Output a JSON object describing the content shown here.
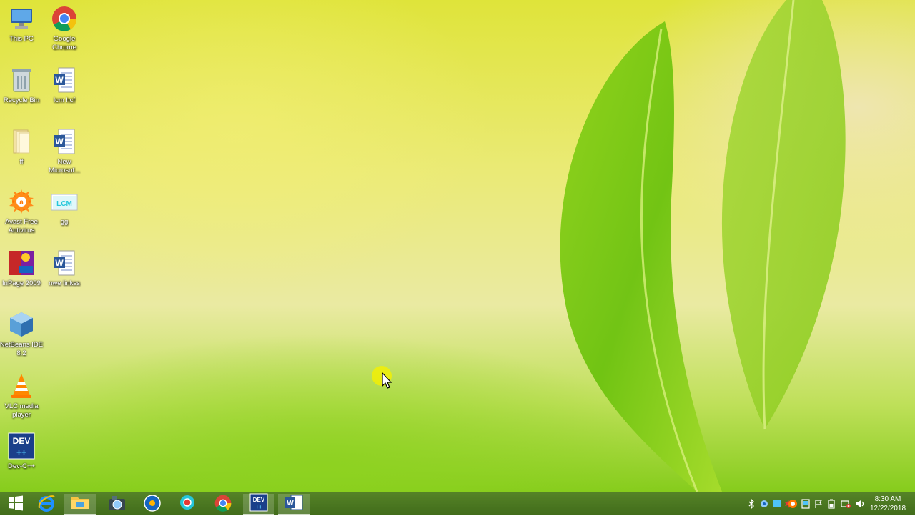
{
  "desktop": {
    "icons": [
      {
        "label": "This PC"
      },
      {
        "label": "Google Chrome"
      },
      {
        "label": "Recycle Bin"
      },
      {
        "label": "lcm hcf"
      },
      {
        "label": "ff"
      },
      {
        "label": "New Microsof..."
      },
      {
        "label": "Avast Free Antivirus"
      },
      {
        "label": "gg"
      },
      {
        "label": "InPage 2009"
      },
      {
        "label": "nwe linkss"
      },
      {
        "label": "NetBeans IDE 8.2"
      },
      {
        "label": "VLC media player"
      },
      {
        "label": "Dev-C++"
      }
    ]
  },
  "taskbar": {
    "buttons": [
      {
        "icon": "windows-start-icon"
      },
      {
        "icon": "internet-explorer-icon"
      },
      {
        "icon": "file-explorer-icon"
      },
      {
        "icon": "camera-app-icon"
      },
      {
        "icon": "media-player-icon"
      },
      {
        "icon": "recorder-app-icon"
      },
      {
        "icon": "chrome-icon"
      },
      {
        "icon": "dev-cpp-icon"
      },
      {
        "icon": "word-icon"
      }
    ],
    "clock": {
      "time": "8:30 AM",
      "date": "12/22/2018"
    },
    "dev_text": "DEV",
    "word_letter": "W"
  },
  "colors": {
    "taskbar": "#4a7a16",
    "word_blue": "#2b579a",
    "chrome_red": "#db4437",
    "chrome_yellow": "#f4c20d",
    "chrome_green": "#0f9d58",
    "chrome_blue": "#4285f4"
  }
}
